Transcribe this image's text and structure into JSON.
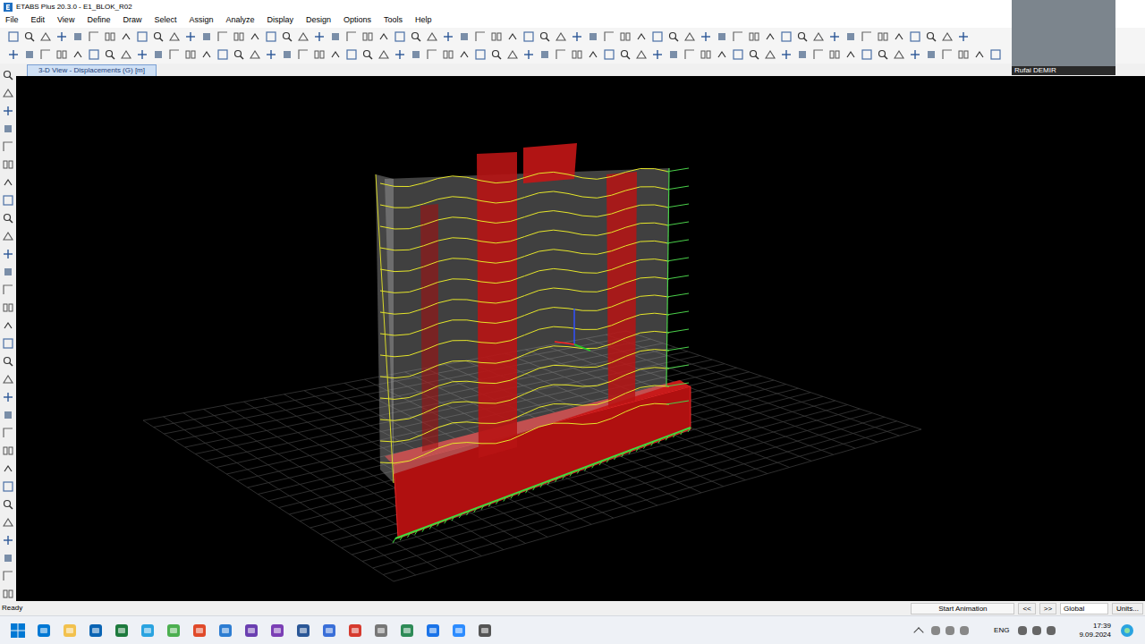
{
  "window": {
    "title": "ETABS Plus 20.3.0 - E1_BLOK_R02"
  },
  "menu": [
    "File",
    "Edit",
    "View",
    "Define",
    "Draw",
    "Select",
    "Assign",
    "Analyze",
    "Display",
    "Design",
    "Options",
    "Tools",
    "Help"
  ],
  "view_tab": {
    "label": "3-D View - Displacements (G) [m]",
    "selected": true
  },
  "webcam": {
    "name": "Rufai DEMIR"
  },
  "status_bar": {
    "message": "Ready",
    "animation_button": "Start Animation",
    "prev": "<<",
    "next": ">>",
    "coordinate_system": "Global",
    "units": "Units..."
  },
  "taskbar": {
    "language": "ENG",
    "time": "17:39",
    "date": "9.09.2024"
  }
}
